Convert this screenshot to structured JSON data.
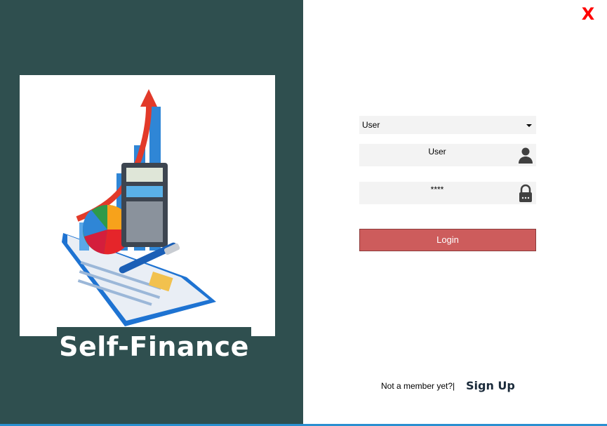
{
  "app": {
    "name": "Self-Finance"
  },
  "window": {
    "close_label": "X"
  },
  "login": {
    "role_selected": "User",
    "username_value": "User",
    "password_mask": "****",
    "login_label": "Login"
  },
  "signup": {
    "prompt": "Not a member yet?|",
    "link_label": "Sign Up"
  },
  "colors": {
    "left_panel": "#2f4f4f",
    "login_button": "#cd5c5c",
    "close_icon": "#ff0000",
    "accent_line": "#2a8fd0"
  },
  "icons": [
    "finance-illustration",
    "dropdown-arrow-icon",
    "user-icon",
    "lock-icon",
    "close-icon"
  ]
}
